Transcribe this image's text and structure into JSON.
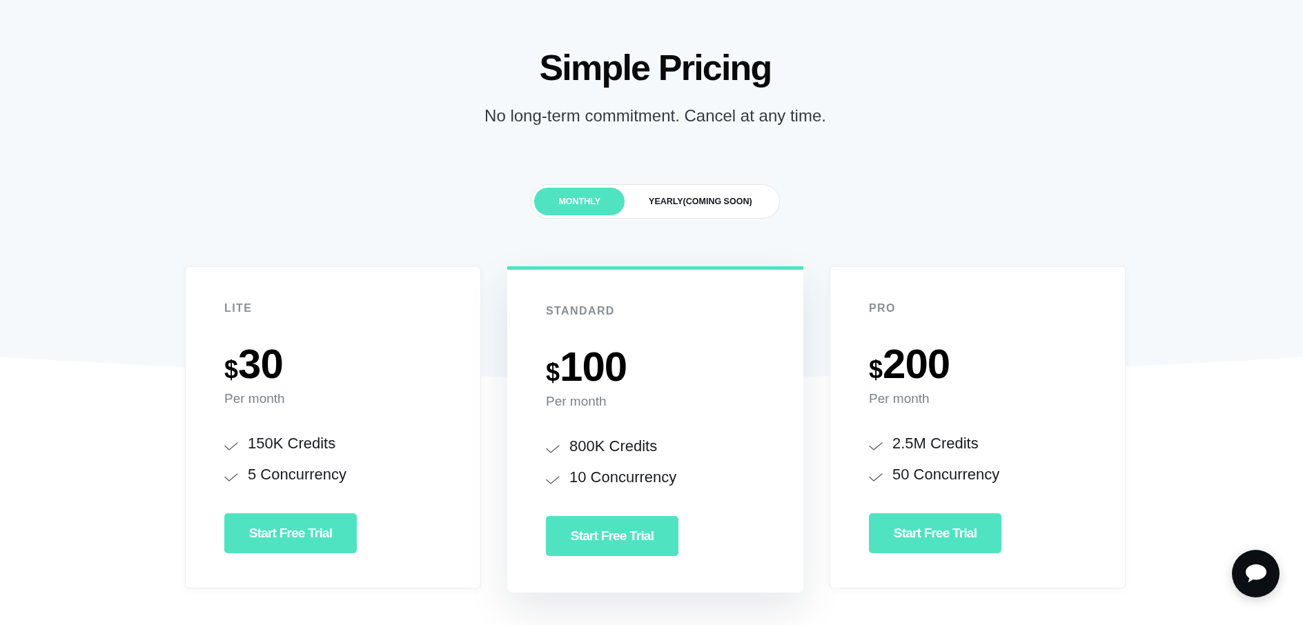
{
  "header": {
    "title": "Simple Pricing",
    "subtitle": "No long-term commitment. Cancel at any time."
  },
  "billing_toggle": [
    {
      "label": "MONTHLY",
      "selected": true
    },
    {
      "label": "YEARLY(COMING SOON)",
      "selected": false
    }
  ],
  "plans": [
    {
      "name": "LITE",
      "currency": "$",
      "price": "30",
      "period": "Per month",
      "featured": false,
      "features": [
        "150K Credits",
        "5 Concurrency"
      ],
      "button": "Start Free Trial"
    },
    {
      "name": "STANDARD",
      "currency": "$",
      "price": "100",
      "period": "Per month",
      "featured": true,
      "features": [
        "800K Credits",
        "10 Concurrency"
      ],
      "button": "Start Free Trial"
    },
    {
      "name": "PRO",
      "currency": "$",
      "price": "200",
      "period": "Per month",
      "featured": false,
      "features": [
        "2.5M Credits",
        "50 Concurrency"
      ],
      "button": "Start Free Trial"
    }
  ]
}
